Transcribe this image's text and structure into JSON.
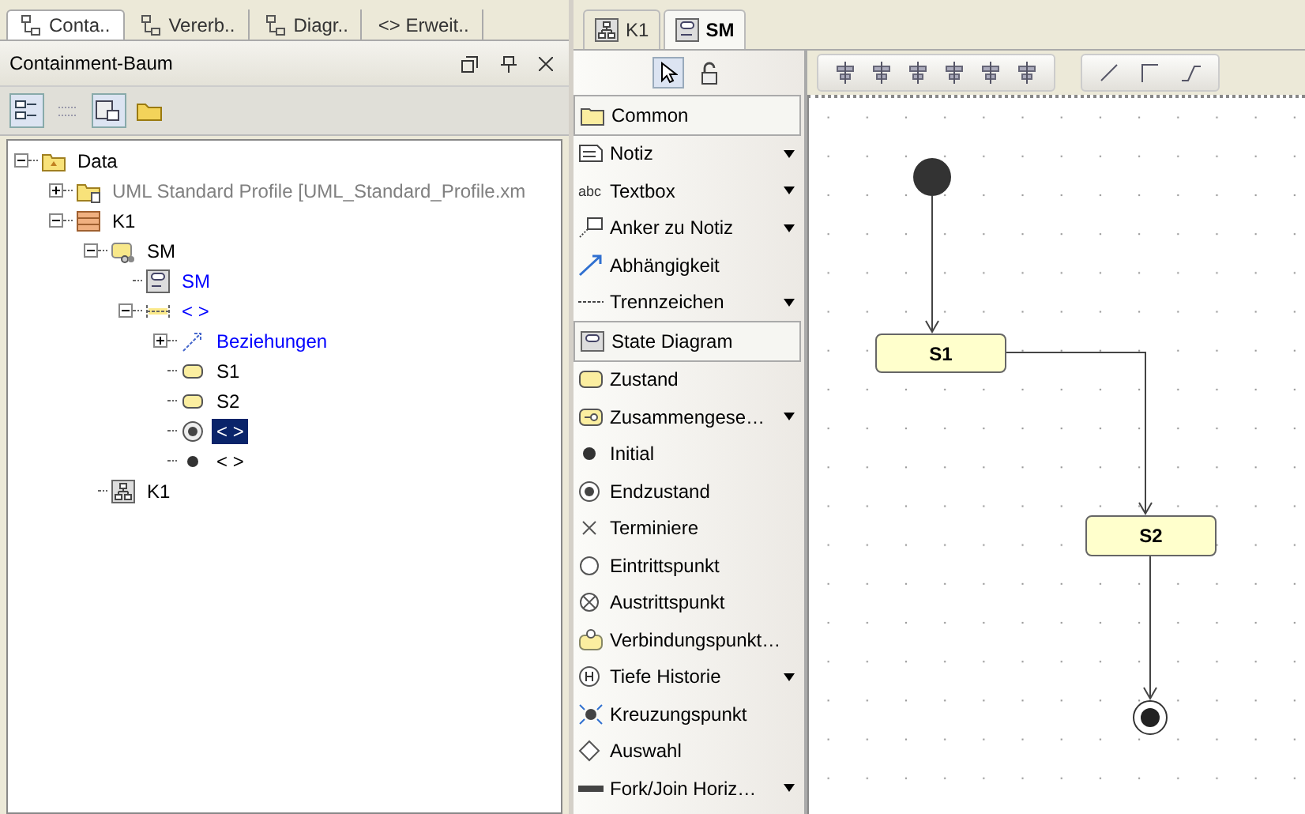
{
  "left_panel": {
    "tabs": [
      {
        "label": "Conta..",
        "selected": true
      },
      {
        "label": "Vererb..",
        "selected": false
      },
      {
        "label": "Diagr..",
        "selected": false
      },
      {
        "label": "<> Erweit..",
        "selected": false
      }
    ],
    "title": "Containment-Baum",
    "toolbar": [
      {
        "pressed": true
      },
      {
        "pressed": false
      },
      {
        "pressed": true
      },
      {
        "pressed": false
      }
    ],
    "tree": [
      {
        "label": "Data",
        "kind": "package",
        "color": "#000000",
        "selected": false,
        "expanded": true,
        "children": [
          {
            "label": "UML Standard Profile [UML_Standard_Profile.xm",
            "kind": "profile",
            "color": "#808080",
            "selected": false,
            "expanded": false
          },
          {
            "label": "K1",
            "kind": "class",
            "color": "#000000",
            "selected": false,
            "expanded": true,
            "children": [
              {
                "label": "SM",
                "kind": "statemachine",
                "color": "#000000",
                "selected": false,
                "expanded": true,
                "children": [
                  {
                    "label": "SM",
                    "kind": "diagram",
                    "color": "#0000ff",
                    "selected": false
                  },
                  {
                    "label": "< >",
                    "kind": "region",
                    "color": "#0000ff",
                    "selected": false,
                    "expanded": true,
                    "children": [
                      {
                        "label": "Beziehungen",
                        "kind": "relations",
                        "color": "#0000ff",
                        "selected": false,
                        "expanded": false
                      },
                      {
                        "label": "S1",
                        "kind": "state",
                        "color": "#000000",
                        "selected": false
                      },
                      {
                        "label": "S2",
                        "kind": "state",
                        "color": "#000000",
                        "selected": false
                      },
                      {
                        "label": "< >",
                        "kind": "final",
                        "selected": true
                      },
                      {
                        "label": "< >",
                        "kind": "initial",
                        "color": "#000000",
                        "selected": false
                      }
                    ]
                  }
                ]
              },
              {
                "label": "K1",
                "kind": "classdiagram",
                "color": "#000000",
                "selected": false
              }
            ]
          }
        ]
      }
    ]
  },
  "editor": {
    "tabs": [
      {
        "label": "K1",
        "kind": "classdiagram",
        "selected": false
      },
      {
        "label": "SM",
        "kind": "diagram",
        "selected": true
      }
    ],
    "palette_tools": [
      {
        "pressed": true
      },
      {
        "pressed": false
      }
    ],
    "palette": [
      {
        "kind": "group",
        "label": "Common",
        "dropdown": false
      },
      {
        "kind": "note",
        "label": "Notiz",
        "dropdown": true
      },
      {
        "kind": "textbox",
        "icon_text": "abc",
        "label": "Textbox",
        "dropdown": true
      },
      {
        "kind": "anchor",
        "label": "Anker zu Notiz",
        "dropdown": true
      },
      {
        "kind": "dependency",
        "label": "Abhängigkeit",
        "dropdown": false
      },
      {
        "kind": "separator",
        "label": "Trennzeichen",
        "dropdown": true
      },
      {
        "kind": "group",
        "label": "State Diagram",
        "dropdown": false
      },
      {
        "kind": "state",
        "label": "Zustand",
        "dropdown": false
      },
      {
        "kind": "composite",
        "label": "Zusammengese…",
        "dropdown": true
      },
      {
        "kind": "initial",
        "label": "Initial",
        "dropdown": false
      },
      {
        "kind": "final",
        "label": "Endzustand",
        "dropdown": false
      },
      {
        "kind": "terminate",
        "label": "Terminiere",
        "dropdown": false
      },
      {
        "kind": "entry",
        "label": "Eintrittspunkt",
        "dropdown": false
      },
      {
        "kind": "exit",
        "label": "Austrittspunkt",
        "dropdown": false
      },
      {
        "kind": "connection",
        "label": "Verbindungspunkt…",
        "dropdown": false
      },
      {
        "kind": "history",
        "label": "Tiefe Historie",
        "dropdown": true
      },
      {
        "kind": "junction",
        "label": "Kreuzungspunkt",
        "dropdown": false
      },
      {
        "kind": "choice",
        "label": "Auswahl",
        "dropdown": false
      },
      {
        "kind": "fork",
        "label": "Fork/Join Horiz…",
        "dropdown": true
      }
    ],
    "diagram": {
      "nodes": [
        {
          "kind": "initial"
        },
        {
          "kind": "state",
          "label": "S1"
        },
        {
          "kind": "state",
          "label": "S2"
        },
        {
          "kind": "final"
        }
      ]
    }
  }
}
